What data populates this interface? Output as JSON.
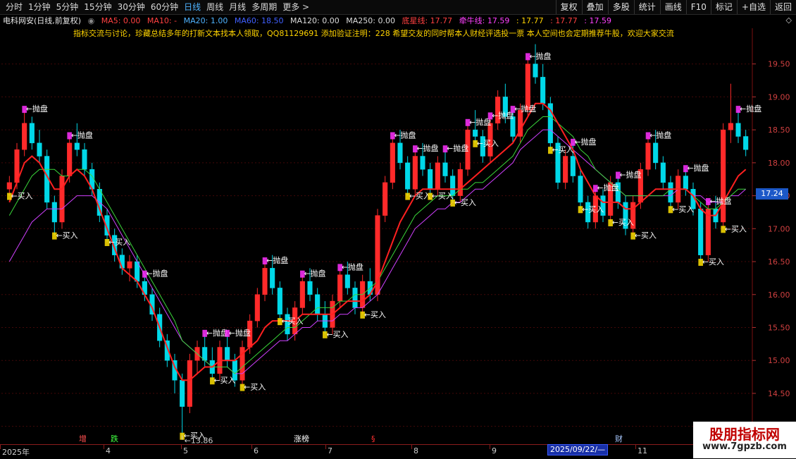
{
  "toolbar": {
    "periods": [
      "分时",
      "1分钟",
      "5分钟",
      "15分钟",
      "30分钟",
      "60分钟",
      "日线",
      "周线",
      "月线",
      "多周期",
      "更多 >"
    ],
    "active_period": "日线",
    "actions": [
      "复权",
      "叠加",
      "多股",
      "统计",
      "画线",
      "F10",
      "标记",
      "+自选",
      "返回"
    ]
  },
  "info": {
    "stock_name": "电科网安(日线,前复权)",
    "ma5": "MA5: 0.00",
    "ma10": "MA10: -",
    "ma20": "MA20: 1.00",
    "ma60": "MA60: 18.50",
    "ma120": "MA120: 0.00",
    "ma250": "MA250: 0.00",
    "dixing": "底星线: 17.77",
    "qianniu": "牵牛线: 17.59",
    "v3": ": 17.77",
    "v4": ": 17.77",
    "v5": ": 17.59"
  },
  "banner": "指标交流与讨论，珍藏总结多年的打新文本找本人领取，QQ81129691 添加验证注明：228 希望交友的同时帮本人财经评选投一票     本人空间也会定期推荐牛股，欢迎大家交流",
  "colors": {
    "up": "#ff2a2a",
    "down": "#00d8e8",
    "ma_red": "#ff2020",
    "ma_green": "#3ad63a",
    "ma_purple": "#d040ff",
    "signal_yellow": "#ffe000",
    "signal_magenta": "#ff30ff",
    "grid": "#7a1010",
    "tag_blue": "#1c58c8"
  },
  "current_price": "17.24",
  "low_marker": "13.86",
  "signals": {
    "sell": "←抛盘",
    "buy": "←买入"
  },
  "event_marks": [
    {
      "text": "增",
      "color": "#ff5050"
    },
    {
      "text": "跌",
      "color": "#40ff40"
    },
    {
      "text": "涨榜",
      "color": "#ffffff"
    },
    {
      "text": "§",
      "color": "#ff3030"
    },
    {
      "text": "财",
      "color": "#a8c8ff"
    }
  ],
  "dates": {
    "labels": [
      "2025年",
      "4",
      "5",
      "6",
      "7",
      "8",
      "9",
      "11"
    ],
    "highlighted": "2025/09/22/—"
  },
  "watermark": {
    "title": "股朋指标网",
    "url": "www.7gpzb.com"
  },
  "chart_data": {
    "type": "candlestick",
    "y_axis_labels": [
      "19.50",
      "19.00",
      "18.50",
      "18.00",
      "17.50",
      "17.00",
      "16.50",
      "16.00",
      "15.50",
      "15.00",
      "14.50",
      "14.00"
    ],
    "ylim": [
      13.75,
      19.85
    ],
    "candles": [
      [
        17.6,
        17.8,
        17.5,
        17.7
      ],
      [
        17.7,
        18.3,
        17.6,
        18.2
      ],
      [
        18.2,
        18.8,
        18.1,
        18.6
      ],
      [
        18.6,
        18.7,
        18.2,
        18.3
      ],
      [
        18.3,
        18.5,
        18.0,
        18.1
      ],
      [
        18.1,
        18.2,
        17.3,
        17.4
      ],
      [
        17.4,
        17.5,
        16.9,
        17.1
      ],
      [
        17.1,
        17.9,
        17.0,
        17.8
      ],
      [
        17.8,
        18.4,
        17.7,
        18.3
      ],
      [
        18.3,
        18.6,
        18.1,
        18.2
      ],
      [
        18.2,
        18.3,
        17.8,
        17.9
      ],
      [
        17.9,
        18.0,
        17.5,
        17.6
      ],
      [
        17.6,
        17.7,
        17.1,
        17.2
      ],
      [
        17.2,
        17.3,
        16.8,
        16.9
      ],
      [
        16.9,
        17.0,
        16.5,
        16.6
      ],
      [
        16.6,
        16.7,
        16.3,
        16.4
      ],
      [
        16.4,
        16.6,
        16.2,
        16.5
      ],
      [
        16.5,
        16.6,
        16.1,
        16.2
      ],
      [
        16.2,
        16.3,
        15.9,
        16.0
      ],
      [
        16.0,
        16.1,
        15.6,
        15.7
      ],
      [
        15.7,
        15.8,
        15.2,
        15.3
      ],
      [
        15.3,
        15.4,
        14.9,
        15.0
      ],
      [
        15.0,
        15.1,
        14.5,
        14.7
      ],
      [
        14.7,
        14.8,
        13.86,
        14.3
      ],
      [
        14.3,
        15.1,
        14.2,
        15.0
      ],
      [
        15.0,
        15.3,
        14.8,
        15.2
      ],
      [
        15.2,
        15.4,
        14.9,
        15.0
      ],
      [
        15.0,
        15.2,
        14.7,
        14.8
      ],
      [
        14.8,
        15.3,
        14.7,
        15.2
      ],
      [
        15.2,
        15.4,
        14.9,
        15.0
      ],
      [
        15.0,
        15.1,
        14.6,
        14.7
      ],
      [
        14.7,
        15.3,
        14.6,
        15.2
      ],
      [
        15.2,
        15.7,
        15.1,
        15.6
      ],
      [
        15.6,
        16.1,
        15.5,
        16.0
      ],
      [
        16.0,
        16.5,
        15.9,
        16.4
      ],
      [
        16.4,
        16.6,
        16.0,
        16.1
      ],
      [
        16.1,
        16.2,
        15.6,
        15.7
      ],
      [
        15.7,
        15.8,
        15.3,
        15.4
      ],
      [
        15.4,
        15.9,
        15.3,
        15.8
      ],
      [
        15.8,
        16.3,
        15.7,
        16.2
      ],
      [
        16.2,
        16.4,
        15.9,
        16.0
      ],
      [
        16.0,
        16.1,
        15.6,
        15.7
      ],
      [
        15.7,
        15.9,
        15.4,
        15.5
      ],
      [
        15.5,
        16.0,
        15.4,
        15.9
      ],
      [
        15.9,
        16.4,
        15.8,
        16.3
      ],
      [
        16.3,
        16.5,
        16.0,
        16.1
      ],
      [
        16.1,
        16.2,
        15.7,
        15.8
      ],
      [
        15.8,
        16.3,
        15.7,
        16.2
      ],
      [
        16.2,
        16.4,
        15.9,
        16.0
      ],
      [
        16.0,
        17.3,
        15.9,
        17.2
      ],
      [
        17.2,
        17.8,
        17.1,
        17.7
      ],
      [
        17.7,
        18.4,
        17.6,
        18.3
      ],
      [
        18.3,
        18.5,
        17.9,
        18.0
      ],
      [
        18.0,
        18.1,
        17.5,
        17.6
      ],
      [
        17.6,
        18.2,
        17.5,
        18.1
      ],
      [
        18.1,
        18.3,
        17.8,
        17.9
      ],
      [
        17.9,
        18.0,
        17.5,
        17.6
      ],
      [
        17.6,
        18.1,
        17.5,
        18.0
      ],
      [
        18.0,
        18.2,
        17.7,
        17.8
      ],
      [
        17.8,
        17.9,
        17.4,
        17.5
      ],
      [
        17.5,
        18.0,
        17.4,
        17.9
      ],
      [
        17.9,
        18.6,
        17.8,
        18.5
      ],
      [
        18.5,
        18.8,
        18.3,
        18.4
      ],
      [
        18.4,
        18.5,
        18.0,
        18.1
      ],
      [
        18.1,
        18.7,
        18.0,
        18.6
      ],
      [
        18.6,
        19.1,
        18.5,
        19.0
      ],
      [
        19.0,
        19.2,
        18.6,
        18.7
      ],
      [
        18.7,
        18.8,
        18.3,
        18.4
      ],
      [
        18.4,
        18.9,
        18.3,
        18.8
      ],
      [
        18.8,
        19.6,
        18.7,
        19.5
      ],
      [
        19.5,
        19.8,
        19.2,
        19.3
      ],
      [
        19.3,
        19.5,
        18.8,
        18.9
      ],
      [
        18.9,
        19.0,
        18.2,
        18.3
      ],
      [
        18.3,
        18.4,
        17.6,
        17.7
      ],
      [
        17.7,
        18.2,
        17.6,
        18.1
      ],
      [
        18.1,
        18.3,
        17.7,
        17.8
      ],
      [
        17.8,
        17.9,
        17.3,
        17.4
      ],
      [
        17.4,
        17.5,
        17.0,
        17.1
      ],
      [
        17.1,
        17.6,
        17.0,
        17.5
      ],
      [
        17.5,
        17.6,
        17.1,
        17.2
      ],
      [
        17.2,
        17.8,
        17.1,
        17.7
      ],
      [
        17.7,
        17.8,
        17.3,
        17.4
      ],
      [
        17.4,
        17.5,
        16.9,
        17.0
      ],
      [
        17.0,
        17.5,
        16.9,
        17.4
      ],
      [
        17.4,
        18.0,
        17.3,
        17.9
      ],
      [
        17.9,
        18.4,
        17.8,
        18.3
      ],
      [
        18.3,
        18.5,
        17.9,
        18.0
      ],
      [
        18.0,
        18.1,
        17.6,
        17.7
      ],
      [
        17.7,
        17.8,
        17.3,
        17.4
      ],
      [
        17.4,
        17.9,
        17.3,
        17.8
      ],
      [
        17.8,
        17.9,
        17.5,
        17.6
      ],
      [
        17.6,
        17.7,
        17.2,
        17.3
      ],
      [
        17.3,
        17.4,
        16.5,
        16.6
      ],
      [
        16.6,
        17.4,
        16.5,
        17.3
      ],
      [
        17.3,
        17.5,
        17.0,
        17.1
      ],
      [
        17.1,
        18.6,
        17.0,
        18.5
      ],
      [
        18.5,
        19.2,
        18.3,
        18.6
      ],
      [
        18.6,
        18.8,
        18.3,
        18.4
      ],
      [
        18.4,
        18.5,
        18.1,
        18.2
      ]
    ],
    "ma_red_values": [
      17.4,
      17.7,
      18.0,
      18.1,
      18.0,
      17.8,
      17.6,
      17.6,
      17.8,
      17.9,
      17.8,
      17.6,
      17.3,
      17.0,
      16.7,
      16.4,
      16.3,
      16.2,
      16.0,
      15.8,
      15.5,
      15.2,
      14.9,
      14.7,
      14.7,
      14.8,
      14.9,
      14.9,
      15.0,
      15.0,
      15.0,
      15.1,
      15.2,
      15.3,
      15.5,
      15.6,
      15.6,
      15.6,
      15.6,
      15.7,
      15.7,
      15.7,
      15.7,
      15.7,
      15.8,
      15.9,
      15.9,
      15.9,
      16.0,
      16.2,
      16.5,
      16.8,
      17.1,
      17.3,
      17.5,
      17.6,
      17.6,
      17.6,
      17.6,
      17.6,
      17.6,
      17.7,
      17.8,
      17.9,
      18.0,
      18.1,
      18.2,
      18.3,
      18.5,
      18.7,
      18.9,
      18.9,
      18.8,
      18.6,
      18.4,
      18.2,
      17.9,
      17.7,
      17.5,
      17.4,
      17.4,
      17.4,
      17.3,
      17.3,
      17.4,
      17.5,
      17.6,
      17.6,
      17.6,
      17.6,
      17.6,
      17.5,
      17.3,
      17.2,
      17.2,
      17.4,
      17.6,
      17.8,
      17.9
    ],
    "ma_green_values": [
      17.2,
      17.4,
      17.6,
      17.8,
      17.9,
      17.9,
      17.9,
      17.8,
      17.8,
      17.9,
      17.9,
      17.8,
      17.6,
      17.4,
      17.2,
      17.0,
      16.8,
      16.6,
      16.4,
      16.2,
      16.0,
      15.8,
      15.6,
      15.3,
      15.2,
      15.1,
      15.0,
      14.9,
      14.9,
      14.9,
      14.8,
      14.9,
      15.0,
      15.1,
      15.2,
      15.3,
      15.4,
      15.5,
      15.5,
      15.6,
      15.7,
      15.8,
      15.8,
      15.8,
      15.9,
      15.9,
      16.0,
      16.0,
      16.1,
      16.2,
      16.4,
      16.6,
      16.8,
      17.0,
      17.2,
      17.3,
      17.4,
      17.5,
      17.5,
      17.5,
      17.6,
      17.6,
      17.7,
      17.7,
      17.8,
      17.9,
      18.0,
      18.1,
      18.3,
      18.5,
      18.6,
      18.7,
      18.7,
      18.6,
      18.5,
      18.4,
      18.2,
      18.1,
      17.9,
      17.8,
      17.7,
      17.6,
      17.5,
      17.5,
      17.5,
      17.5,
      17.5,
      17.5,
      17.6,
      17.6,
      17.6,
      17.5,
      17.4,
      17.3,
      17.3,
      17.4,
      17.5,
      17.6,
      17.6
    ],
    "ma_purple_values": [
      16.5,
      16.7,
      16.9,
      17.1,
      17.2,
      17.3,
      17.3,
      17.3,
      17.4,
      17.5,
      17.5,
      17.5,
      17.4,
      17.3,
      17.1,
      16.9,
      16.7,
      16.5,
      16.3,
      16.1,
      15.9,
      15.7,
      15.5,
      15.3,
      15.2,
      15.1,
      15.0,
      14.9,
      14.9,
      14.9,
      14.8,
      14.8,
      14.9,
      15.0,
      15.1,
      15.2,
      15.3,
      15.3,
      15.4,
      15.5,
      15.5,
      15.6,
      15.6,
      15.6,
      15.7,
      15.7,
      15.8,
      15.8,
      15.9,
      16.0,
      16.2,
      16.4,
      16.6,
      16.8,
      17.0,
      17.1,
      17.2,
      17.3,
      17.3,
      17.4,
      17.4,
      17.5,
      17.6,
      17.6,
      17.7,
      17.8,
      17.9,
      18.0,
      18.2,
      18.3,
      18.4,
      18.5,
      18.5,
      18.4,
      18.3,
      18.2,
      18.1,
      18.0,
      17.9,
      17.8,
      17.7,
      17.6,
      17.5,
      17.5,
      17.5,
      17.5,
      17.5,
      17.5,
      17.5,
      17.6,
      17.6,
      17.5,
      17.5,
      17.4,
      17.4,
      17.4,
      17.5,
      17.5,
      17.6
    ]
  }
}
